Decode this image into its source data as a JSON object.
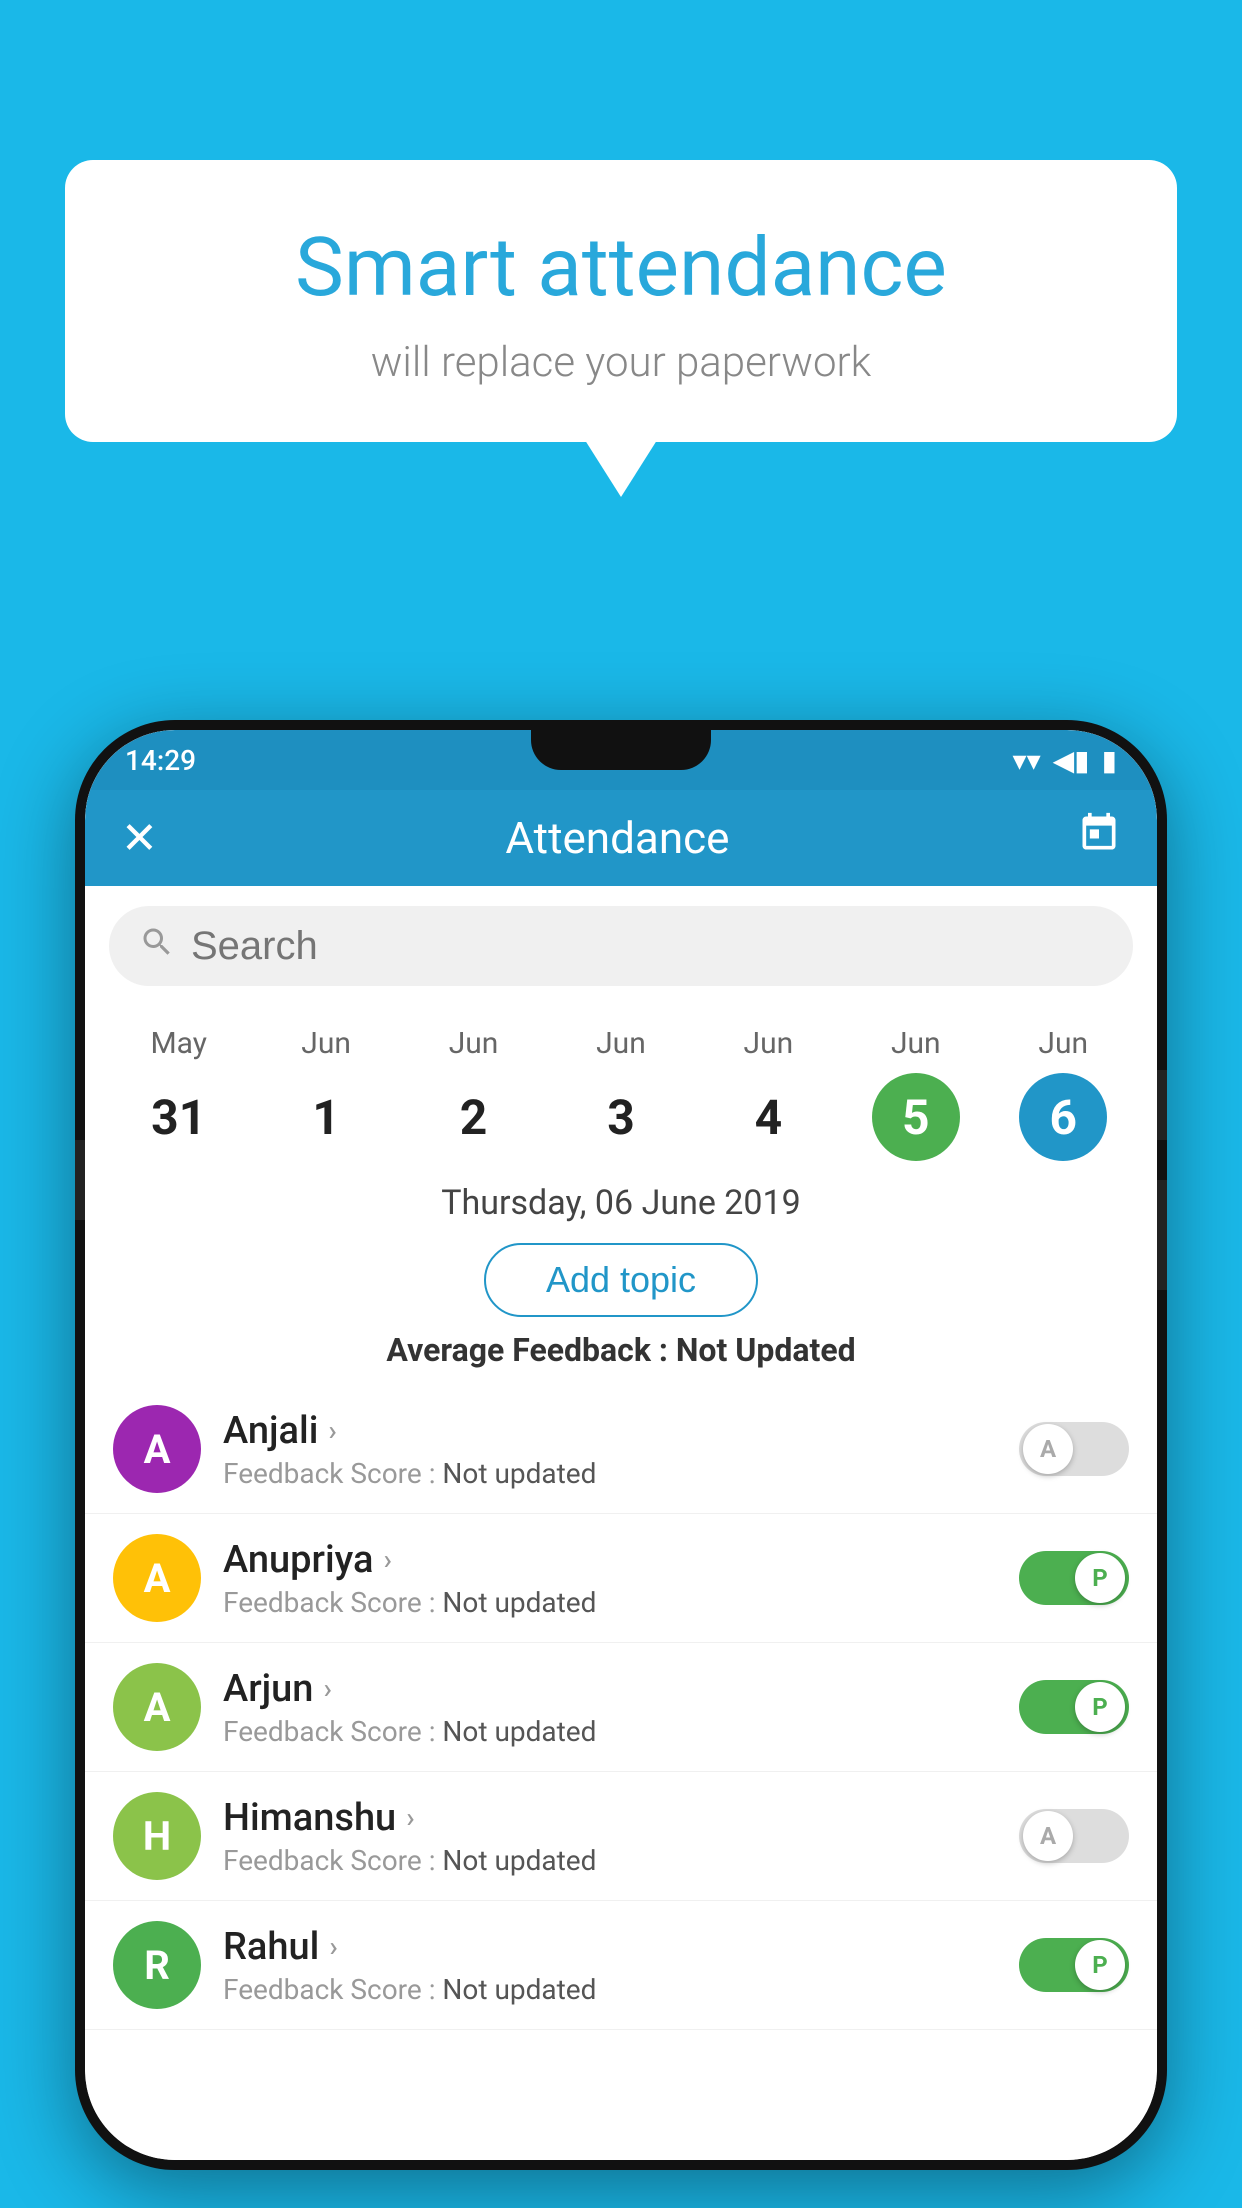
{
  "background_color": "#1ab8e8",
  "speech_bubble": {
    "heading": "Smart attendance",
    "subtext": "will replace your paperwork"
  },
  "phone": {
    "status_bar": {
      "time": "14:29",
      "wifi": "▾",
      "signal": "▲",
      "battery": "▮"
    },
    "app_bar": {
      "close_icon": "✕",
      "title": "Attendance",
      "calendar_icon": "📅"
    },
    "search": {
      "placeholder": "Search"
    },
    "calendar": {
      "days": [
        {
          "month": "May",
          "date": "31",
          "state": "normal"
        },
        {
          "month": "Jun",
          "date": "1",
          "state": "normal"
        },
        {
          "month": "Jun",
          "date": "2",
          "state": "normal"
        },
        {
          "month": "Jun",
          "date": "3",
          "state": "normal"
        },
        {
          "month": "Jun",
          "date": "4",
          "state": "normal"
        },
        {
          "month": "Jun",
          "date": "5",
          "state": "today"
        },
        {
          "month": "Jun",
          "date": "6",
          "state": "selected"
        }
      ]
    },
    "selected_date_label": "Thursday, 06 June 2019",
    "add_topic_label": "Add topic",
    "avg_feedback_label": "Average Feedback : ",
    "avg_feedback_value": "Not Updated",
    "students": [
      {
        "name": "Anjali",
        "avatar_letter": "A",
        "avatar_color": "#9c27b0",
        "feedback": "Feedback Score : ",
        "feedback_value": "Not updated",
        "toggle_state": "off",
        "toggle_letter": "A"
      },
      {
        "name": "Anupriya",
        "avatar_letter": "A",
        "avatar_color": "#ffc107",
        "feedback": "Feedback Score : ",
        "feedback_value": "Not updated",
        "toggle_state": "on",
        "toggle_letter": "P"
      },
      {
        "name": "Arjun",
        "avatar_letter": "A",
        "avatar_color": "#8bc34a",
        "feedback": "Feedback Score : ",
        "feedback_value": "Not updated",
        "toggle_state": "on",
        "toggle_letter": "P"
      },
      {
        "name": "Himanshu",
        "avatar_letter": "H",
        "avatar_color": "#8bc34a",
        "feedback": "Feedback Score : ",
        "feedback_value": "Not updated",
        "toggle_state": "off",
        "toggle_letter": "A"
      },
      {
        "name": "Rahul",
        "avatar_letter": "R",
        "avatar_color": "#4caf50",
        "feedback": "Feedback Score : ",
        "feedback_value": "Not updated",
        "toggle_state": "on",
        "toggle_letter": "P"
      }
    ]
  }
}
